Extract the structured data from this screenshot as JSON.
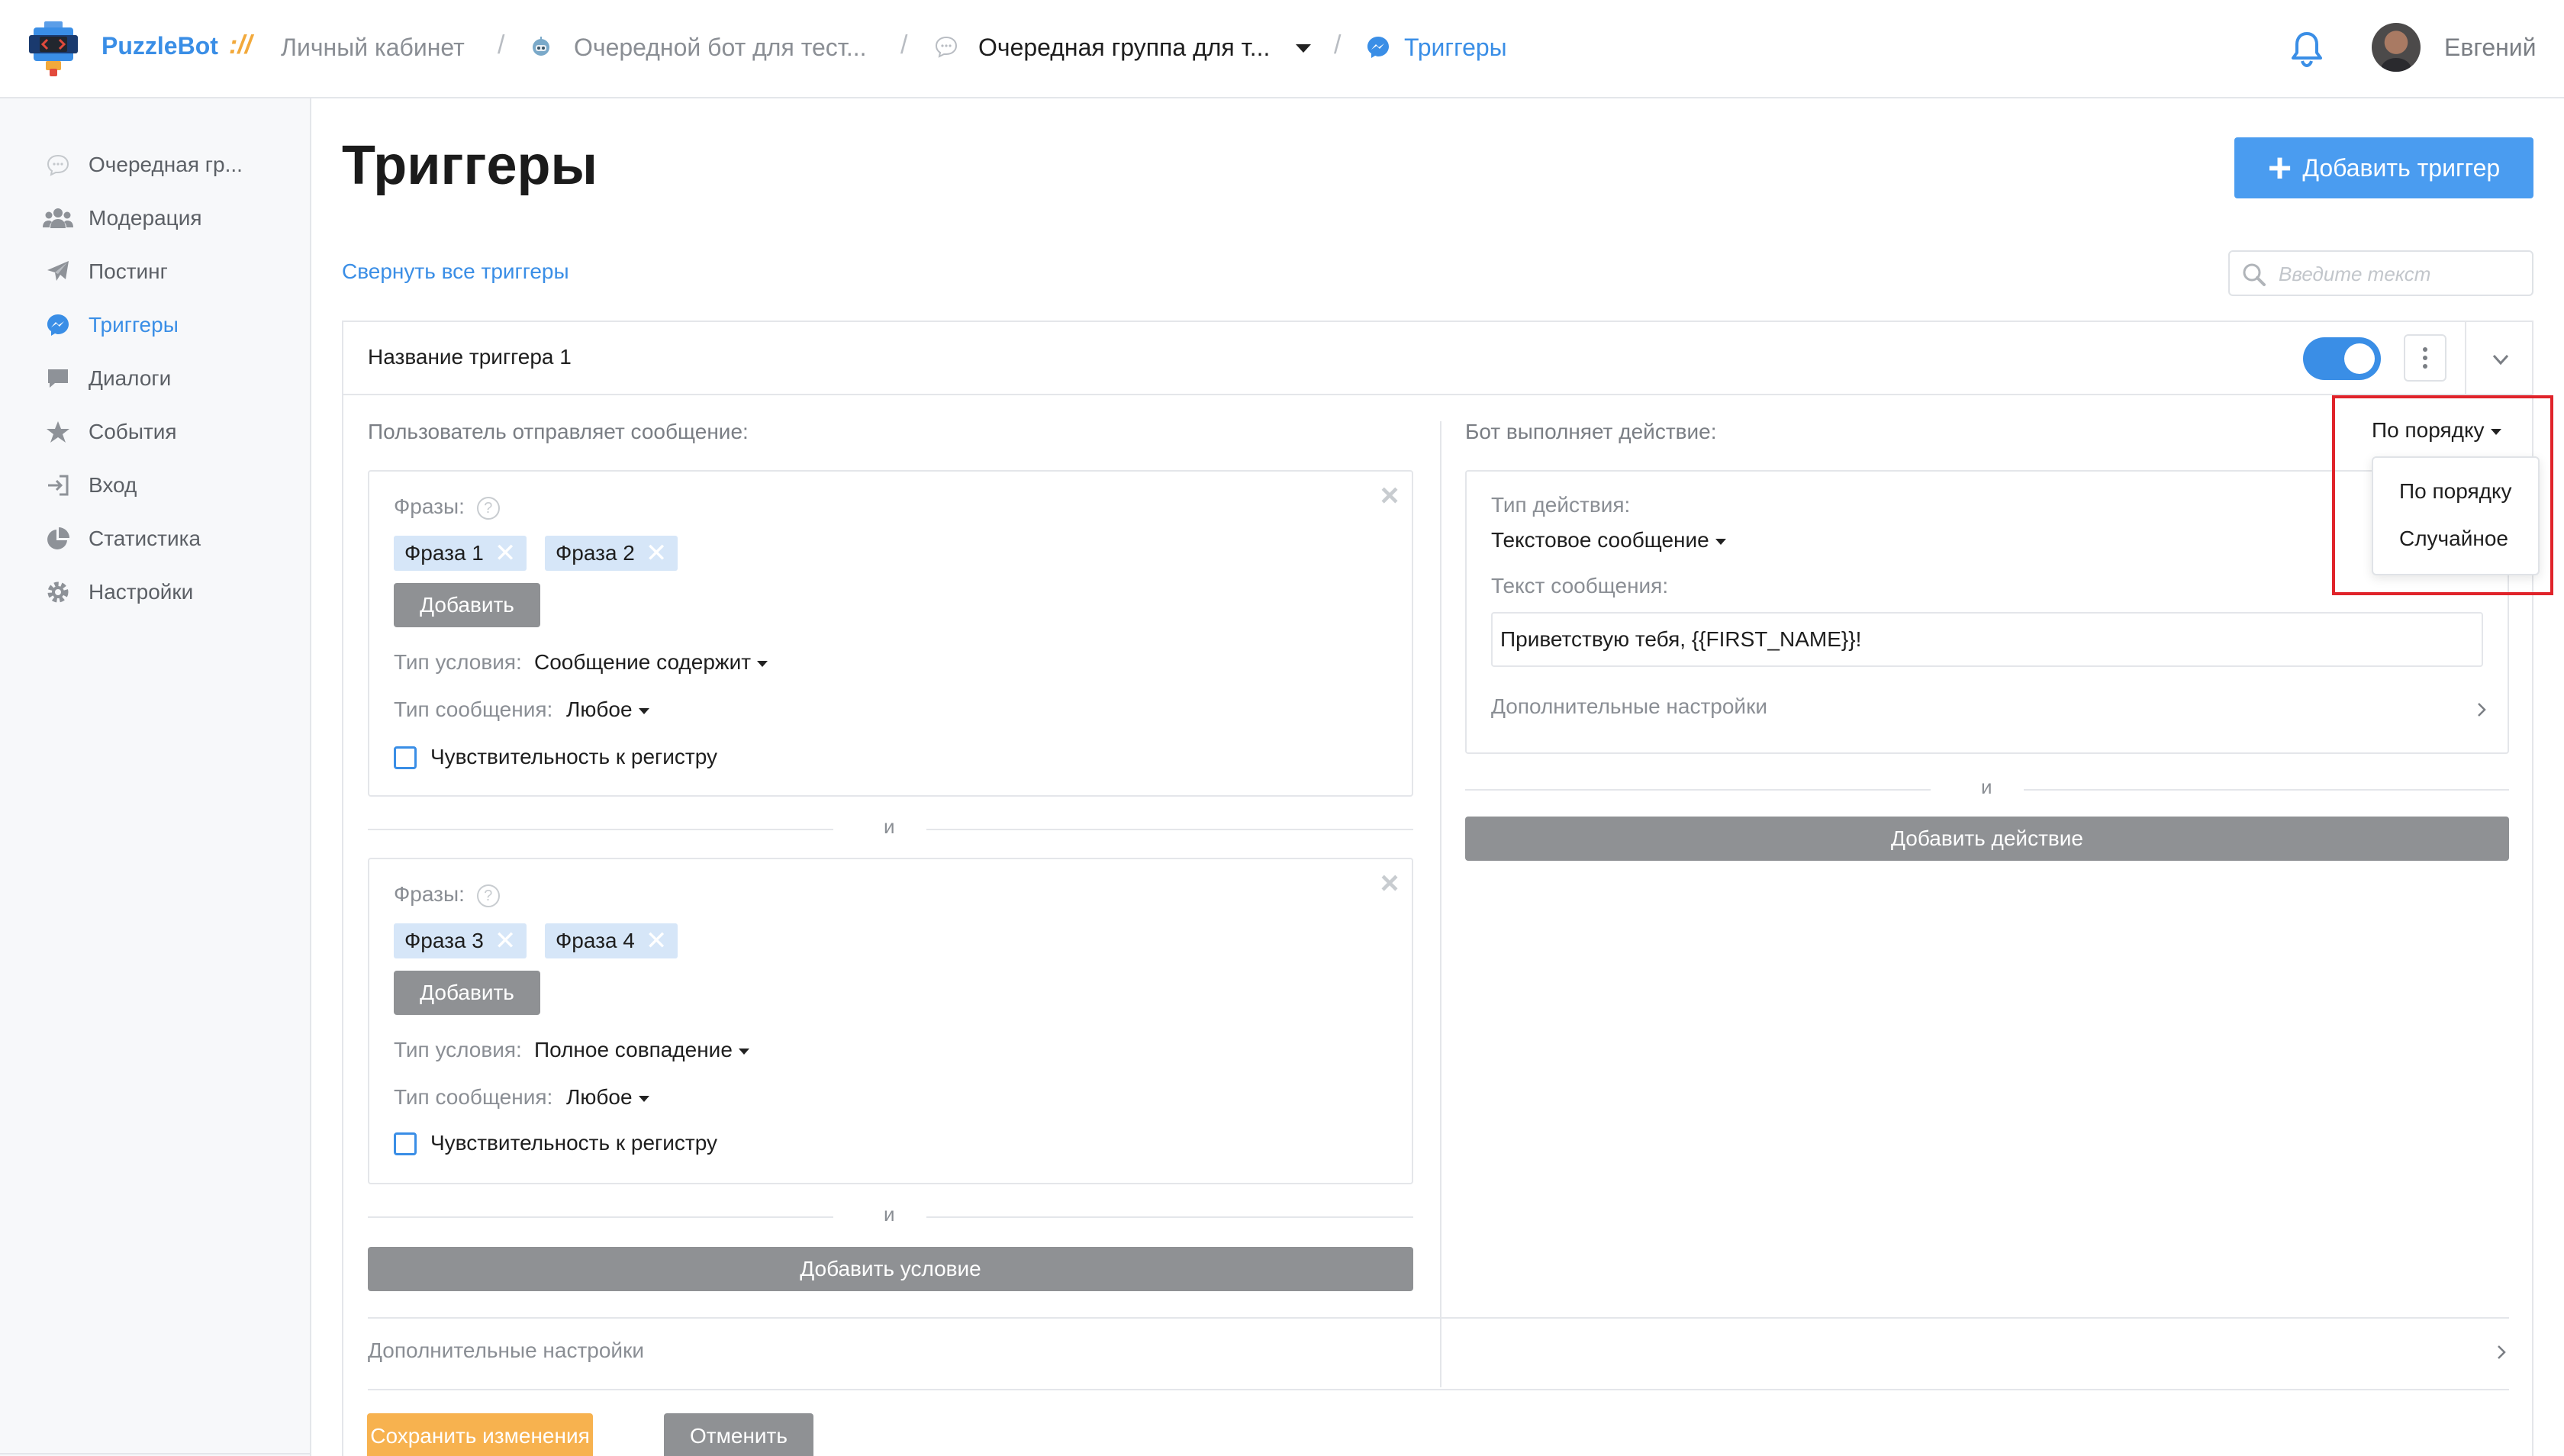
{
  "header": {
    "brand": "PuzzleBot",
    "brand_sep": "://",
    "breadcrumbs": [
      {
        "label": "Личный кабинет"
      },
      {
        "label": "Очередной бот для тест..."
      },
      {
        "label": "Очередная группа для т..."
      },
      {
        "label": "Триггеры"
      }
    ],
    "username": "Евгений"
  },
  "sidebar": {
    "items": [
      {
        "label": "Очередная гр...",
        "icon": "chat-bubble-icon"
      },
      {
        "label": "Модерация",
        "icon": "users-icon"
      },
      {
        "label": "Постинг",
        "icon": "paper-plane-icon"
      },
      {
        "label": "Триггеры",
        "icon": "messenger-icon"
      },
      {
        "label": "Диалоги",
        "icon": "comment-icon"
      },
      {
        "label": "События",
        "icon": "star-icon"
      },
      {
        "label": "Вход",
        "icon": "sign-in-icon"
      },
      {
        "label": "Статистика",
        "icon": "pie-chart-icon"
      },
      {
        "label": "Настройки",
        "icon": "gear-icon"
      }
    ],
    "social": [
      "telegram-icon",
      "vk-icon",
      "facebook-icon",
      "twitter-icon"
    ]
  },
  "main": {
    "title": "Триггеры",
    "add_trigger_label": "Добавить триггер",
    "collapse_all_label": "Свернуть все триггеры",
    "search_placeholder": "Введите текст"
  },
  "trigger": {
    "name": "Название триггера 1",
    "enabled": true,
    "user_section_label": "Пользователь отправляет сообщение:",
    "bot_section_label": "Бот выполняет действие:",
    "conditions": [
      {
        "phrases_label": "Фразы:",
        "phrases": [
          "Фраза 1",
          "Фраза 2"
        ],
        "add_label": "Добавить",
        "condition_type_label": "Тип условия:",
        "condition_type_value": "Сообщение содержит",
        "message_type_label": "Тип сообщения:",
        "message_type_value": "Любое",
        "case_sensitive_label": "Чувствительность к регистру"
      },
      {
        "phrases_label": "Фразы:",
        "phrases": [
          "Фраза 3",
          "Фраза 4"
        ],
        "add_label": "Добавить",
        "condition_type_label": "Тип условия:",
        "condition_type_value": "Полное совпадение",
        "message_type_label": "Тип сообщения:",
        "message_type_value": "Любое",
        "case_sensitive_label": "Чувствительность к регистру"
      }
    ],
    "and_label": "и",
    "add_condition_label": "Добавить условие",
    "action": {
      "action_type_label": "Тип действия:",
      "action_type_value": "Текстовое сообщение",
      "message_text_label": "Текст сообщения:",
      "message_text_value": "Приветствую тебя, {{FIRST_NAME}}!",
      "extra_settings_label": "Дополнительные настройки"
    },
    "add_action_label": "Добавить действие",
    "order": {
      "selected": "По порядку",
      "options": [
        "По порядку",
        "Случайное"
      ]
    },
    "extra_settings_label": "Дополнительные настройки",
    "save_label": "Сохранить изменения",
    "cancel_label": "Отменить"
  },
  "colors": {
    "accent": "#3a8ee6",
    "save": "#f7b24f",
    "highlight": "#e0232a"
  }
}
